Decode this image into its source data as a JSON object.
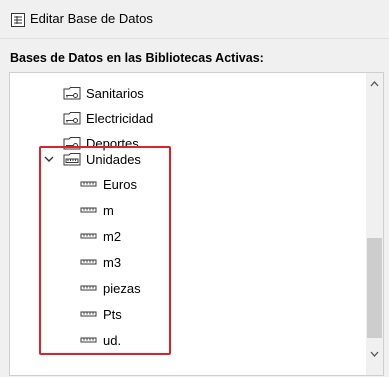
{
  "window": {
    "title": "Editar Base de Datos"
  },
  "section_label": "Bases de Datos en las Bibliotecas Activas:",
  "tree": {
    "parent_items": [
      {
        "label": "Sanitarios"
      },
      {
        "label": "Electricidad"
      },
      {
        "label": "Deportes"
      }
    ],
    "expanded_item": {
      "label": "Unidades",
      "expanded": true
    },
    "child_items": [
      {
        "label": "Euros"
      },
      {
        "label": "m"
      },
      {
        "label": "m2"
      },
      {
        "label": "m3"
      },
      {
        "label": "piezas"
      },
      {
        "label": "Pts"
      },
      {
        "label": "ud."
      }
    ]
  },
  "colors": {
    "highlight": "#e0202a",
    "icon": "#3a3a3a",
    "window_bg": "#f0f0f0"
  },
  "icons": {
    "title": "database-window-icon",
    "parent": "database-key-icon",
    "expanded": "unit-ruler-icon",
    "child": "unit-ruler-icon"
  }
}
